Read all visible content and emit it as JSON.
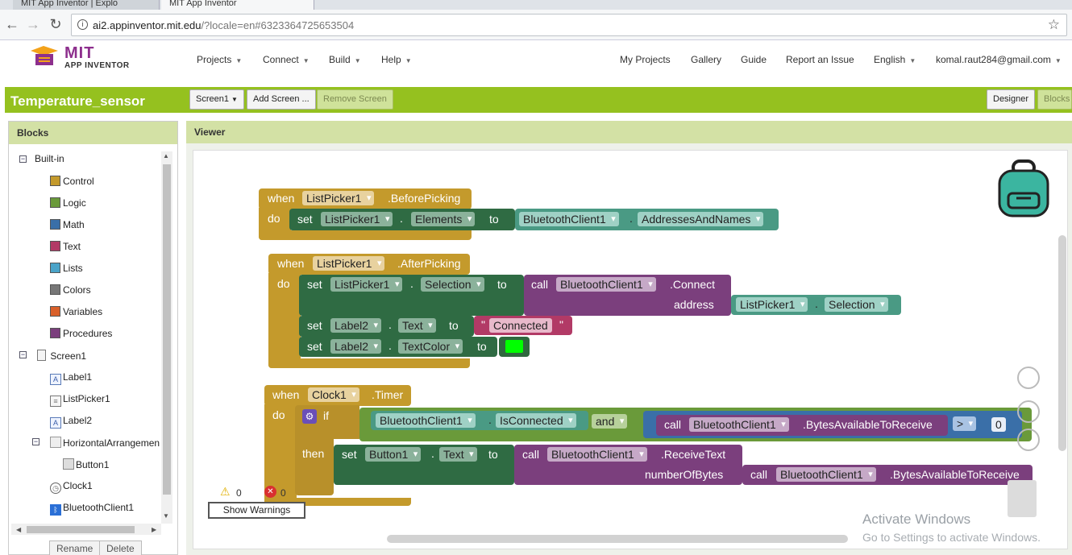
{
  "browser": {
    "tabs": [
      {
        "label": "MIT App Inventor | Explo"
      },
      {
        "label": "MIT App Inventor"
      }
    ],
    "url_host": "ai2.appinventor.mit.edu",
    "url_rest": "/?locale=en#6323364725653504"
  },
  "header": {
    "logo_line1": "MIT",
    "logo_line2": "APP INVENTOR",
    "menus": [
      "Projects",
      "Connect",
      "Build",
      "Help"
    ],
    "right_links": [
      "My Projects",
      "Gallery",
      "Guide",
      "Report an Issue",
      "English",
      "komal.raut284@gmail.com"
    ]
  },
  "toolbar": {
    "project_title": "Temperature_sensor",
    "screen_select": "Screen1",
    "add_screen": "Add Screen ...",
    "remove_screen": "Remove Screen",
    "designer": "Designer",
    "blocks": "Blocks"
  },
  "blocks_panel": {
    "title": "Blocks",
    "builtin_label": "Built-in",
    "builtin": [
      {
        "label": "Control",
        "color": "#c49a2c"
      },
      {
        "label": "Logic",
        "color": "#6a9a3a"
      },
      {
        "label": "Math",
        "color": "#3a6fa8"
      },
      {
        "label": "Text",
        "color": "#b23a66"
      },
      {
        "label": "Lists",
        "color": "#4aa3c8"
      },
      {
        "label": "Colors",
        "color": "#777777"
      },
      {
        "label": "Variables",
        "color": "#d9602a"
      },
      {
        "label": "Procedures",
        "color": "#7b3f7d"
      }
    ],
    "screen_label": "Screen1",
    "components": [
      "Label1",
      "ListPicker1",
      "Label2"
    ],
    "arrangement_label": "HorizontalArrangemen",
    "arrangement_child": "Button1",
    "non_visible": [
      "Clock1",
      "BluetoothClient1"
    ],
    "rename": "Rename",
    "delete": "Delete"
  },
  "viewer": {
    "title": "Viewer",
    "warnings_count": "0",
    "errors_count": "0",
    "show_warnings": "Show Warnings",
    "activate_line1": "Activate Windows",
    "activate_line2": "Go to Settings to activate Windows."
  },
  "code": {
    "b1_when": "when",
    "b1_comp": "ListPicker1",
    "b1_event": ".BeforePicking",
    "b1_do": "do",
    "b1_set": "set",
    "b1_setcomp": "ListPicker1",
    "b1_prop": "Elements",
    "b1_to": "to",
    "b1_valcomp": "BluetoothClient1",
    "b1_valprop": "AddressesAndNames",
    "b2_when": "when",
    "b2_comp": "ListPicker1",
    "b2_event": ".AfterPicking",
    "b2_do": "do",
    "b2_set": "set",
    "b2_setcomp": "ListPicker1",
    "b2_prop": "Selection",
    "b2_to": "to",
    "b2_call": "call",
    "b2_callcomp": "BluetoothClient1",
    "b2_method": ".Connect",
    "b2_arg": "address",
    "b2_argcomp": "ListPicker1",
    "b2_argprop": "Selection",
    "b2_set2": "set",
    "b2_set2comp": "Label2",
    "b2_set2prop": "Text",
    "b2_to2": "to",
    "b2_text": "Connected",
    "b2_set3": "set",
    "b2_set3comp": "Label2",
    "b2_set3prop": "TextColor",
    "b2_to3": "to",
    "b2_color": "#00ff00",
    "b3_when": "when",
    "b3_comp": "Clock1",
    "b3_event": ".Timer",
    "b3_do": "do",
    "b3_if": "if",
    "b3_cond_comp": "BluetoothClient1",
    "b3_cond_prop": "IsConnected",
    "b3_and": "and",
    "b3_call": "call",
    "b3_callcomp": "BluetoothClient1",
    "b3_method": ".BytesAvailableToReceive",
    "b3_op": ">",
    "b3_num": "0",
    "b3_then": "then",
    "b3_set": "set",
    "b3_setcomp": "Button1",
    "b3_setprop": "Text",
    "b3_to": "to",
    "b3_call2": "call",
    "b3_call2comp": "BluetoothClient1",
    "b3_method2": ".ReceiveText",
    "b3_arg": "numberOfBytes",
    "b3_call3": "call",
    "b3_call3comp": "BluetoothClient1",
    "b3_method3": ".BytesAvailableToReceive"
  }
}
